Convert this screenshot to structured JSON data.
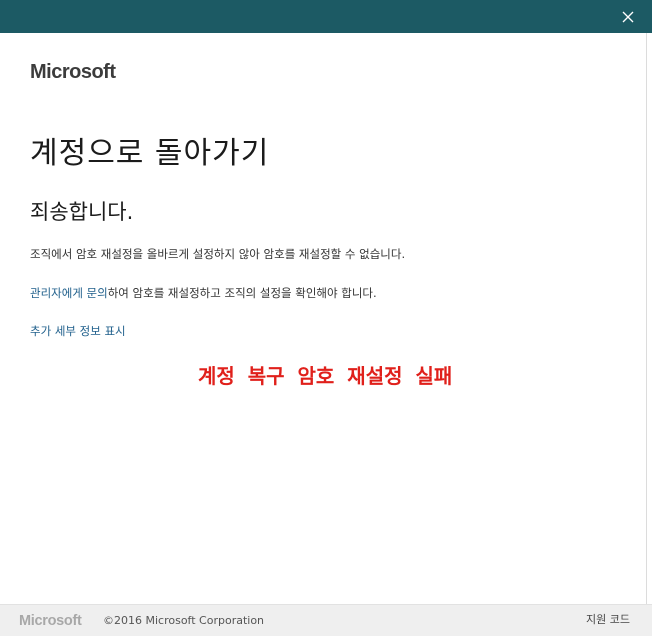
{
  "window": {
    "close_icon": "close-icon",
    "titlebar_color": "#1c5a64"
  },
  "brand": {
    "logo_text": "Microsoft"
  },
  "main": {
    "heading": "계정으로 돌아가기",
    "subheading": "죄송합니다.",
    "message": "조직에서 암호 재설정을 올바르게 설정하지 않아 암호를 재설정할 수 없습니다.",
    "contact_link": "관리자에게 문의",
    "contact_rest": "하여 암호를 재설정하고 조직의 설정을 확인해야 합니다.",
    "details_link": "추가 세부 정보 표시",
    "link_color": "#1f5f8b"
  },
  "annotation": {
    "text": "계정 복구 암호 재설정 실패",
    "color": "#e0201b"
  },
  "footer": {
    "logo_text": "Microsoft",
    "copyright": "©2016 Microsoft Corporation",
    "support_link": "지원 코드"
  }
}
